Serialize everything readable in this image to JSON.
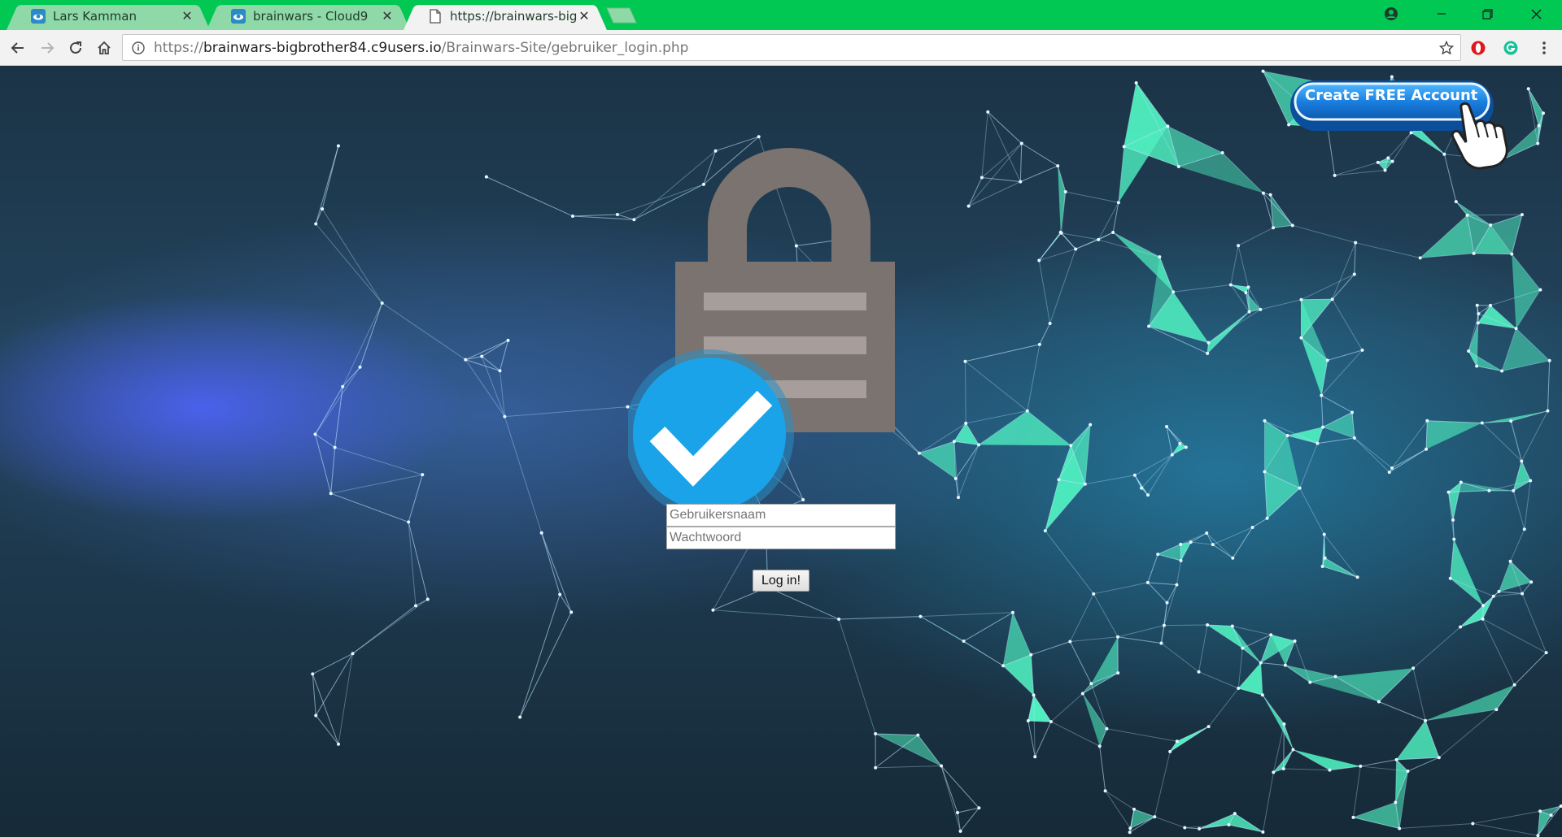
{
  "browser": {
    "tabs": [
      {
        "title": "Lars Kamman",
        "favicon": "cloud9-icon",
        "active": false
      },
      {
        "title": "brainwars - Cloud9",
        "favicon": "cloud9-icon",
        "active": false
      },
      {
        "title": "https://brainwars-bigbro",
        "favicon": "page-icon",
        "active": true
      }
    ],
    "close_glyph": "✕",
    "address_bar": {
      "scheme": "https://",
      "host": "brainwars-bigbrother84.c9users.io",
      "path": "/Brainwars-Site/gebruiker_login.php"
    },
    "colors": {
      "frame": "#00c853",
      "inactive_tab": "#8fd9a8",
      "active_tab": "#f2f2f2"
    }
  },
  "login": {
    "username_placeholder": "Gebruikersnaam",
    "password_placeholder": "Wachtwoord",
    "submit_label": "Log in!"
  },
  "cta": {
    "label": "Create FREE Account"
  },
  "colors": {
    "lock": "#7a7370",
    "check_circle": "#1aa3e8",
    "mesh": "#4ff0c0"
  }
}
